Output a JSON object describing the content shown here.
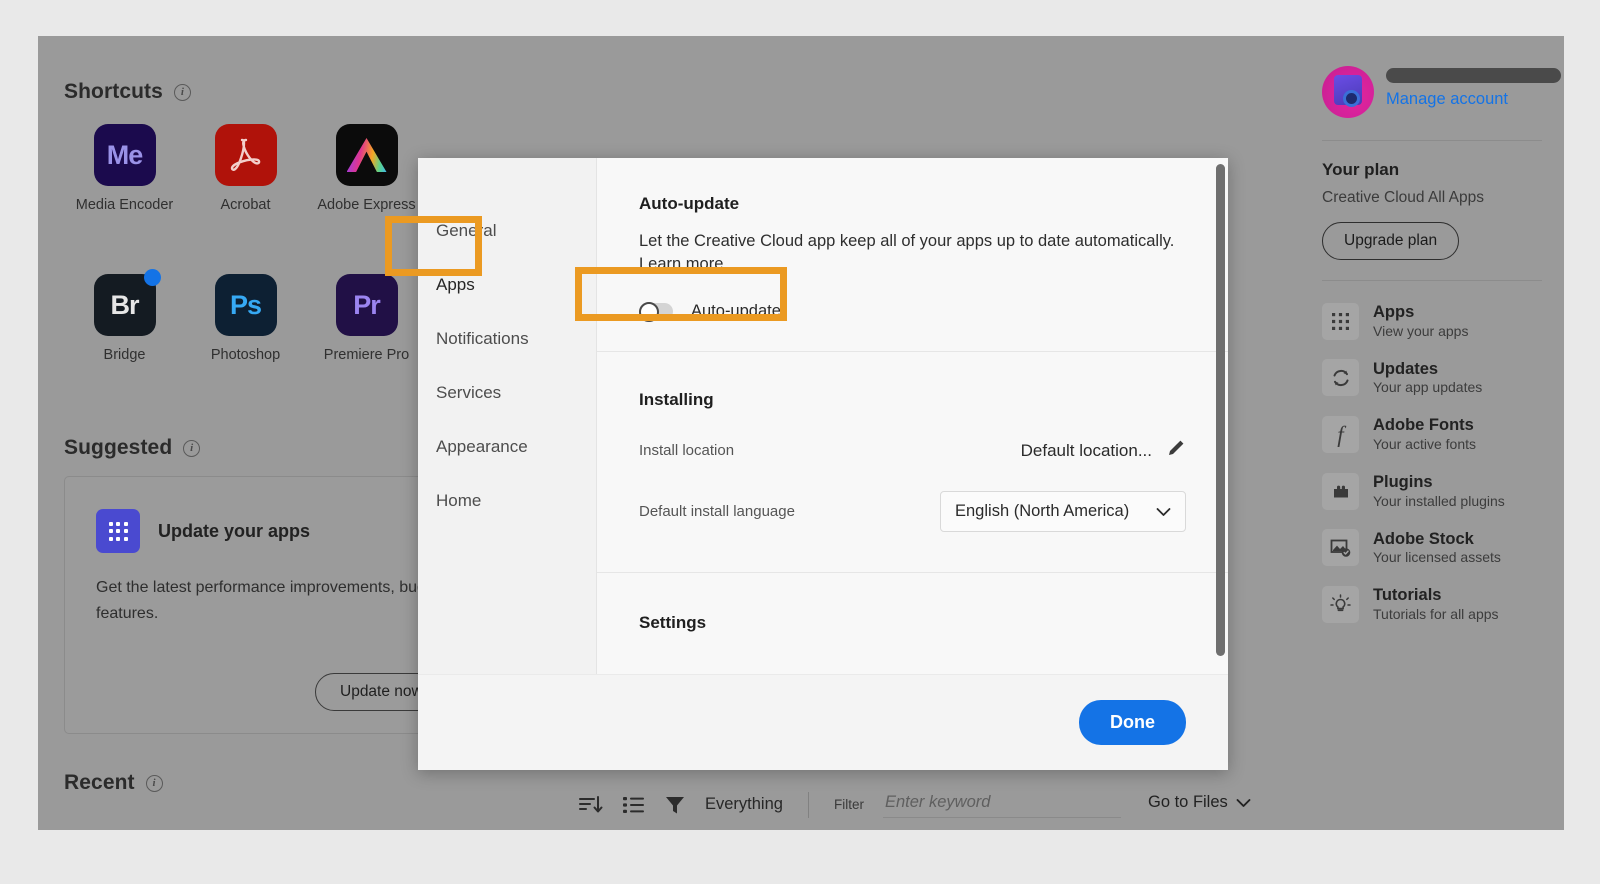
{
  "window": {
    "bg": "#9a9a9a",
    "outer_bg": "#e9e9e9"
  },
  "sections": {
    "shortcuts": "Shortcuts",
    "suggested": "Suggested",
    "recent": "Recent"
  },
  "apps": [
    {
      "name": "Media Encoder",
      "mark": "Me",
      "bg": "#1b0a4d",
      "fg": "#9a92e8",
      "badge": false
    },
    {
      "name": "Acrobat",
      "mark": "acrobat-glyph",
      "bg": "#b0120a",
      "fg": "#f2c9c6",
      "badge": false
    },
    {
      "name": "Adobe Express",
      "mark": "express-glyph",
      "bg": "#0b0b0b",
      "fg": "#ffffff",
      "badge": false
    },
    {
      "name": "Bridge",
      "mark": "Br",
      "bg": "#141b22",
      "fg": "#e6e6e6",
      "badge": true
    },
    {
      "name": "Photoshop",
      "mark": "Ps",
      "bg": "#0d2033",
      "fg": "#36a9f4",
      "badge": false
    },
    {
      "name": "Premiere Pro",
      "mark": "Pr",
      "bg": "#211046",
      "fg": "#9b84f0",
      "badge": false
    }
  ],
  "suggested_card": {
    "title": "Update your apps",
    "body": "Get the latest performance improvements, bug fixes, and app features.",
    "button": "Update now",
    "icon": "apps-grid-icon",
    "icon_color": "#4a4ad0"
  },
  "filter_bar": {
    "sort_icon": "sort-descending-icon",
    "view_icon": "list-view-icon",
    "filter_icon": "funnel-icon",
    "scope": "Everything",
    "filter_label": "Filter",
    "filter_placeholder": "Enter keyword",
    "filter_value": "",
    "go_to_files": "Go to Files"
  },
  "sidebar": {
    "avatar": "user-avatar",
    "name_redacted": true,
    "manage_account": "Manage account",
    "plan_title": "Your plan",
    "plan_name": "Creative Cloud All Apps",
    "upgrade_button": "Upgrade plan",
    "nav": [
      {
        "icon": "apps-grid-icon",
        "title": "Apps",
        "sub": "View your apps"
      },
      {
        "icon": "refresh-icon",
        "title": "Updates",
        "sub": "Your app updates"
      },
      {
        "icon": "font-f-icon",
        "title": "Adobe Fonts",
        "sub": "Your active fonts"
      },
      {
        "icon": "plugin-puzzle-icon",
        "title": "Plugins",
        "sub": "Your installed plugins"
      },
      {
        "icon": "stock-image-check-icon",
        "title": "Adobe Stock",
        "sub": "Your licensed assets"
      },
      {
        "icon": "lightbulb-icon",
        "title": "Tutorials",
        "sub": "Tutorials for all apps"
      }
    ]
  },
  "modal": {
    "nav_items": [
      "General",
      "Apps",
      "Notifications",
      "Services",
      "Appearance",
      "Home"
    ],
    "active_nav": "Apps",
    "auto_update": {
      "heading": "Auto-update",
      "description": "Let the Creative Cloud app keep all of your apps up to date automatically.",
      "learn_more": "Learn more",
      "toggle_label": "Auto-update",
      "toggle_on": false
    },
    "installing": {
      "heading": "Installing",
      "install_location_label": "Install location",
      "install_location_value": "Default location...",
      "edit_icon": "pencil-icon",
      "language_label": "Default install language",
      "language_value": "English (North America)",
      "chevron_icon": "chevron-down-icon"
    },
    "settings_heading": "Settings",
    "done_button": "Done"
  },
  "highlights": {
    "color": "#eb9a22",
    "targets": [
      "apps-nav-item",
      "auto-update-toggle"
    ]
  }
}
